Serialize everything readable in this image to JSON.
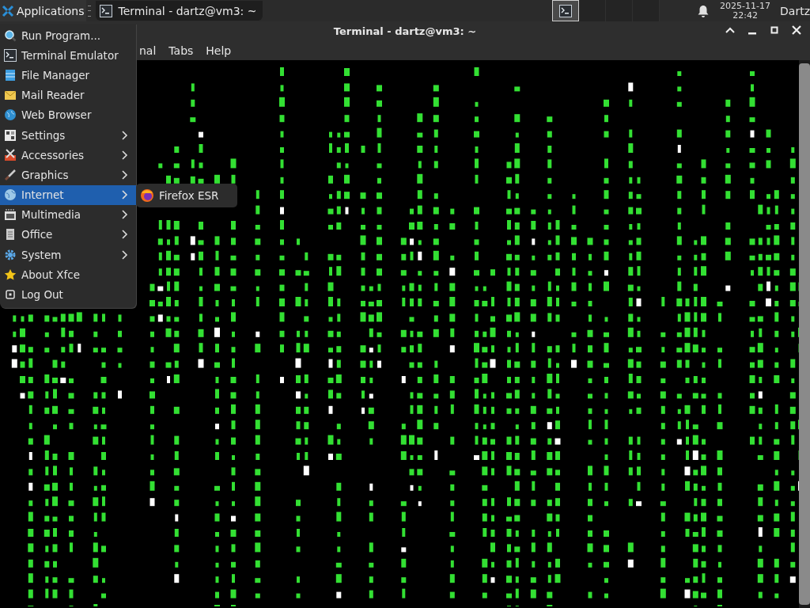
{
  "panel": {
    "applications_label": "Applications",
    "tasks": [
      {
        "label": "Terminal - dartz@vm3: ~",
        "selected": true
      }
    ],
    "workspaces": [
      {
        "selected": true
      },
      {
        "selected": false
      },
      {
        "selected": false
      },
      {
        "selected": false
      }
    ],
    "date": "2025-11-17",
    "time": "22:42",
    "user": "Dartz"
  },
  "window": {
    "title": "Terminal - dartz@vm3: ~",
    "menubar": [
      "nal",
      "Tabs",
      "Help"
    ],
    "terminal": {
      "kind": "matrix"
    }
  },
  "app_menu": {
    "items": [
      {
        "label": "Run Program...",
        "kind": "item",
        "selected": false
      },
      {
        "label": "Terminal Emulator",
        "kind": "item",
        "selected": false
      },
      {
        "label": "File Manager",
        "kind": "item",
        "selected": false
      },
      {
        "label": "Mail Reader",
        "kind": "item",
        "selected": false
      },
      {
        "label": "Web Browser",
        "kind": "item",
        "selected": false
      },
      {
        "label": "Settings",
        "kind": "submenu",
        "selected": false
      },
      {
        "label": "Accessories",
        "kind": "submenu",
        "selected": false
      },
      {
        "label": "Graphics",
        "kind": "submenu",
        "selected": false
      },
      {
        "label": "Internet",
        "kind": "submenu",
        "selected": true
      },
      {
        "label": "Multimedia",
        "kind": "submenu",
        "selected": false
      },
      {
        "label": "Office",
        "kind": "submenu",
        "selected": false
      },
      {
        "label": "System",
        "kind": "submenu",
        "selected": false
      },
      {
        "label": "About Xfce",
        "kind": "item",
        "selected": false
      },
      {
        "label": "Log Out",
        "kind": "item",
        "selected": false
      }
    ],
    "submenu": {
      "items": [
        {
          "label": "Firefox ESR",
          "selected": false
        }
      ]
    }
  }
}
